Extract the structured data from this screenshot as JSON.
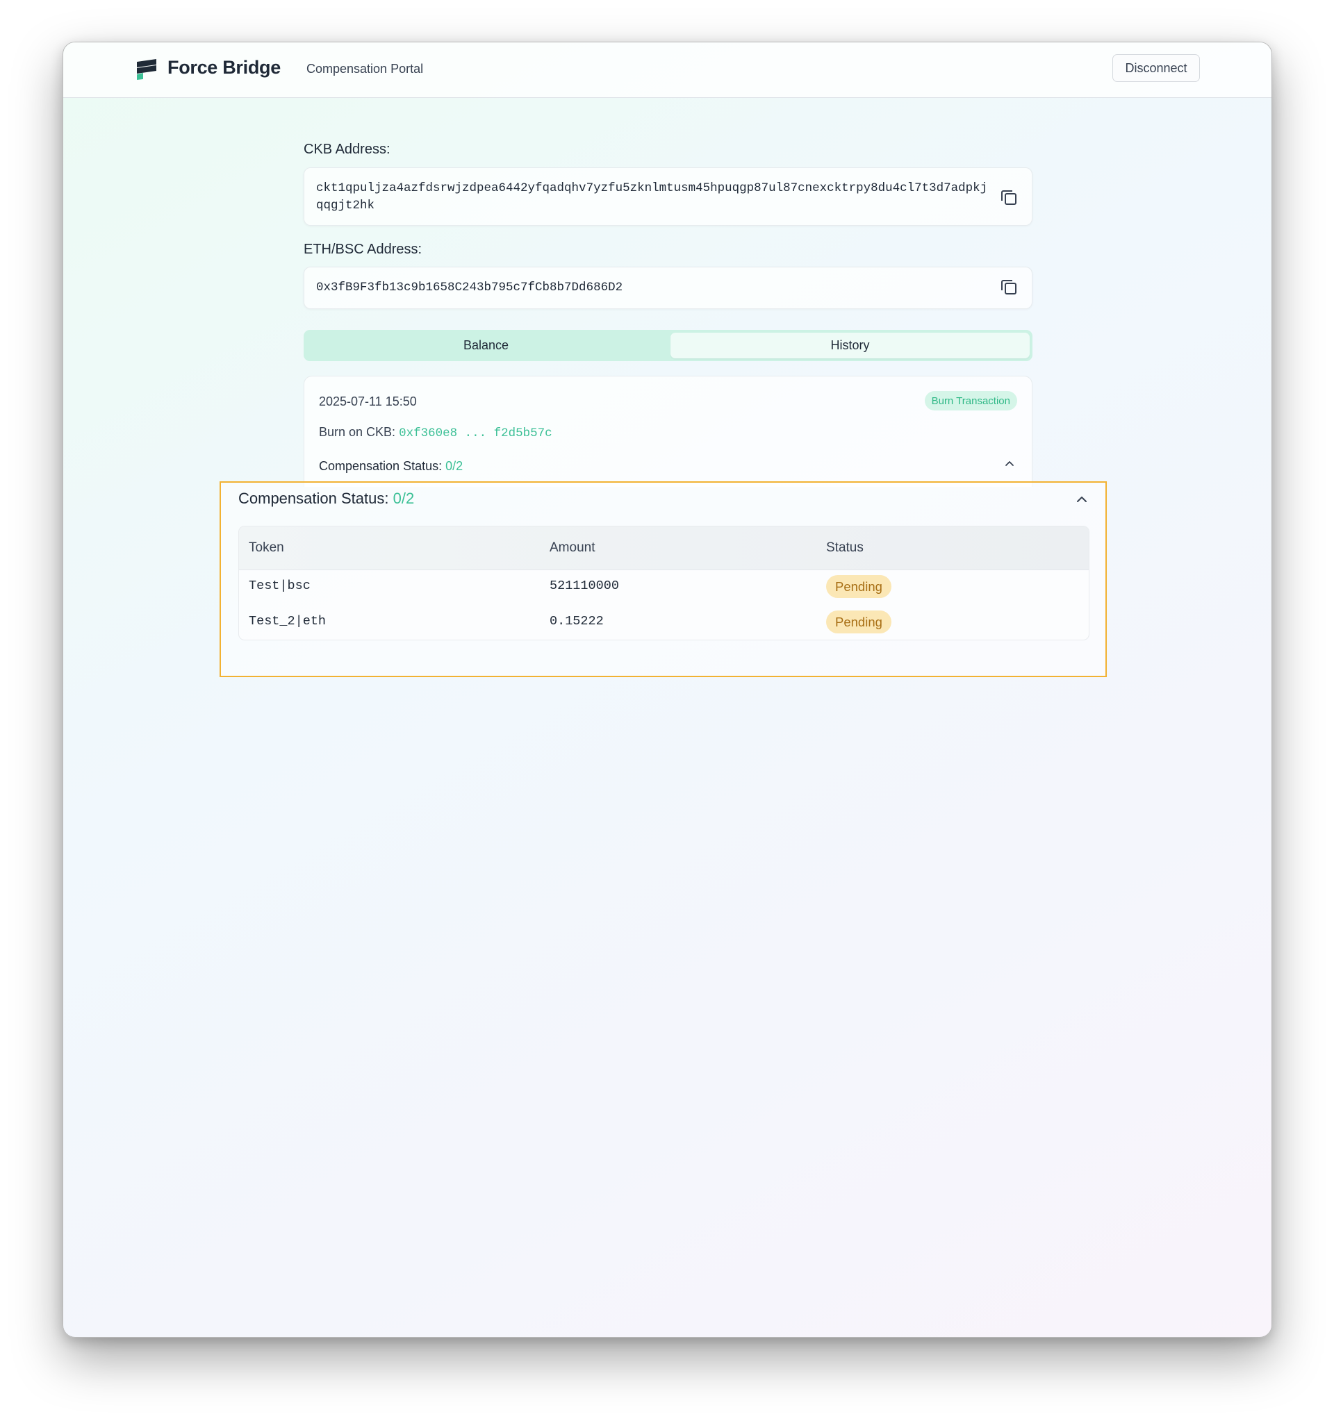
{
  "header": {
    "brand": "Force Bridge",
    "portal_label": "Compensation Portal",
    "disconnect_label": "Disconnect"
  },
  "ckb": {
    "label": "CKB Address:",
    "address": "ckt1qpuljza4azfdsrwjzdpea6442yfqadqhv7yzfu5zknlmtusm45hpuqgp87ul87cnexcktrpy8du4cl7t3d7adpkjqqgjt2hk"
  },
  "eth": {
    "label": "ETH/BSC Address:",
    "address": "0x3fB9F3fb13c9b1658C243b795c7fCb8b7Dd686D2"
  },
  "tabs": {
    "balance": "Balance",
    "history": "History"
  },
  "transaction": {
    "date": "2025-07-11 15:50",
    "badge": "Burn Transaction",
    "burn_label": "Burn on CKB:",
    "burn_hash": "0xf360e8 ... f2d5b57c",
    "comp_label": "Compensation Status:",
    "comp_value": "0/2"
  },
  "compensation": {
    "title": "Compensation Status:",
    "value": "0/2",
    "columns": {
      "token": "Token",
      "amount": "Amount",
      "status": "Status"
    },
    "rows": [
      {
        "token": "Test|bsc",
        "amount": "521110000",
        "status": "Pending"
      },
      {
        "token": "Test_2|eth",
        "amount": "0.15222",
        "status": "Pending"
      }
    ]
  },
  "colors": {
    "accent_green": "#3cc096",
    "pending_bg": "#fbe7b5",
    "highlight_border": "#f2b233"
  },
  "icons": {
    "logo": "force-bridge-logo",
    "copy": "copy-icon",
    "chevron": "chevron-up-icon"
  }
}
